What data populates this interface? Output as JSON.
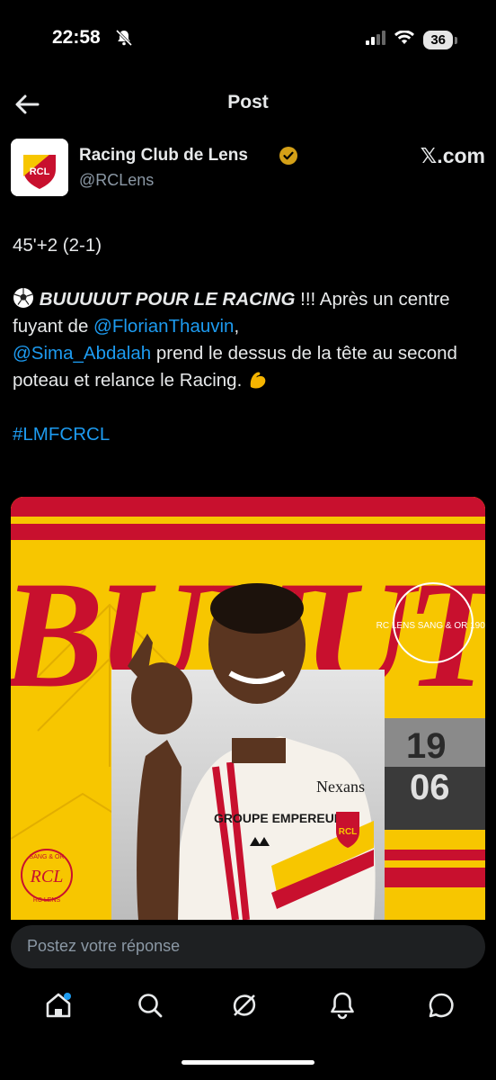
{
  "status_bar": {
    "time": "22:58",
    "battery": "36"
  },
  "header": {
    "title": "Post"
  },
  "author": {
    "name": "Racing Club de Lens",
    "handle": "@RCLens",
    "source": "𝕏.com"
  },
  "post": {
    "line1": "45'+2 (2-1)",
    "bold_text": "BUUUUUT POUR LE RACING",
    "after_bold": " !!! Après un centre fuyant de ",
    "mention1": "@FlorianThauvin",
    "comma": ",",
    "mention2": "@Sima_Abdalah",
    "after_mention2": " prend le dessus de la tête au second poteau et relance le Racing. ",
    "hashtag": "#LMFCRCL"
  },
  "media": {
    "headline": "BUUUT",
    "sponsor": "Nexans",
    "shirt_sponsor": "GROUPE EMPEREUR",
    "crest": "RCL",
    "badge_text": "RC LENS SANG & OR 1906",
    "year_top": "19",
    "year_bottom": "06",
    "logo_text": "SANG & OR",
    "logo_sub": "RC LENS"
  },
  "reply": {
    "placeholder": "Postez votre réponse"
  },
  "nav": {
    "items": [
      "home-icon",
      "search-icon",
      "grok-icon",
      "notifications-icon",
      "messages-icon"
    ]
  },
  "colors": {
    "yellow": "#f7c600",
    "red": "#c8102e",
    "link": "#1d9bf0"
  }
}
